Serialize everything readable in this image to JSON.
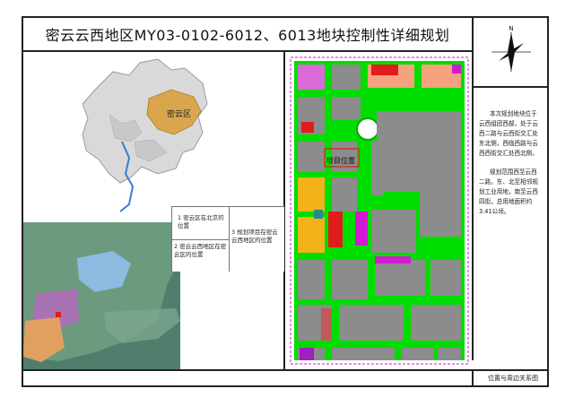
{
  "title": "密云云西地区MY03-0102-6012、6013地块控制性详细规划",
  "north_arrow_icon": "north-arrow-icon",
  "inset_map": {
    "district_label": "密云区",
    "project_label": "项目位置"
  },
  "legend": {
    "item1": "1  密云区在北京的位置",
    "item2": "2  密云云西地区在密云区的位置",
    "item3": "3  规划项目在密云云西地区的位置"
  },
  "description": {
    "para1": "本次规划地块位于云西组团西部，处于云西二路与云西街交汇处东北侧，西临西路与云西西街交汇处西北侧。",
    "para2": "规划范围西至云西二路，东、北至相邻规划工业用地，南至云西四街，总用地面积约3.41公顷。"
  },
  "footer_label": "位置与周边关系图",
  "colors": {
    "road": "#00dd00",
    "block": "#8c8c8c",
    "residential": "#f3b21a",
    "commercial": "#e11c1c",
    "public": "#d11ad1",
    "villa": "#f5a37f",
    "district": "#d9a64e"
  }
}
